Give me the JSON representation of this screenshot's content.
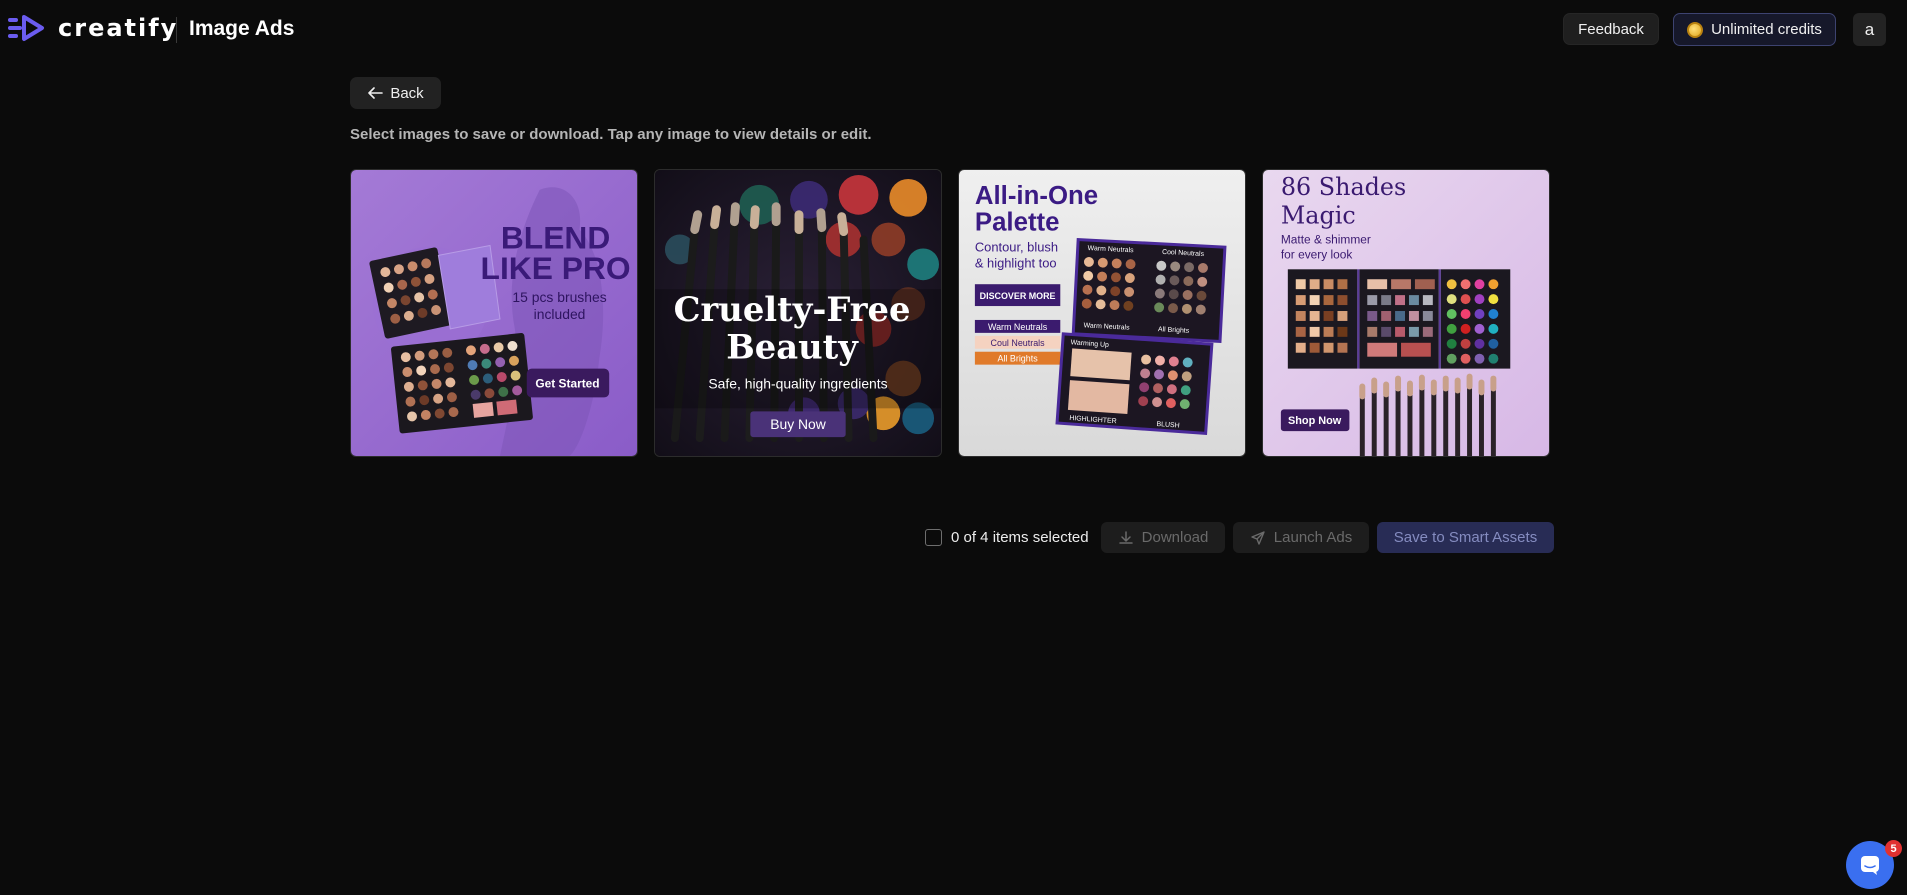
{
  "app": {
    "brand": "creatify",
    "page_title": "Image Ads"
  },
  "header": {
    "feedback_label": "Feedback",
    "credits_label": "Unlimited credits",
    "avatar_initial": "a",
    "credits_icon": "coin-icon"
  },
  "main": {
    "back_label": "Back",
    "instructions": "Select images to save or download. Tap any image to view details or edit."
  },
  "ads": [
    {
      "headline_line1": "BLEND",
      "headline_line2": "LIKE PRO",
      "sub_line1": "15 pcs brushes",
      "sub_line2": "included",
      "cta": "Get Started"
    },
    {
      "headline_line1": "Cruelty-Free",
      "headline_line2": "Beauty",
      "sub": "Safe, high-quality ingredients",
      "cta": "Buy Now"
    },
    {
      "headline_line1": "All-in-One",
      "headline_line2": "Palette",
      "sub_line1": "Contour, blush",
      "sub_line2": "& highlight too",
      "cta": "DISCOVER MORE",
      "tag1": "Warm Neutrals",
      "tag2": "Coul Neutrals",
      "tag3": "All Brights",
      "pal_label1": "Warm Neutrals",
      "pal_label2": "Cool Neutrals",
      "pal_label3": "Warm Neutrals",
      "pal_label4": "All Brights",
      "pal_label5": "Warming Up",
      "pal_label6": "HIGHLIGHTER",
      "pal_label7": "BLUSH"
    },
    {
      "headline_line1": "86 Shades",
      "headline_line2": "Magic",
      "sub_line1": "Matte & shimmer",
      "sub_line2": "for every look",
      "cta": "Shop Now"
    }
  ],
  "actions": {
    "selected_text": "0 of 4 items selected",
    "download_label": "Download",
    "launch_label": "Launch Ads",
    "save_label": "Save to Smart Assets"
  },
  "chat": {
    "badge_count": "5"
  },
  "colors": {
    "background": "#0b0b0b",
    "accent_purple": "#3a1f6e",
    "save_button_bg": "#282c55",
    "chat_blue": "#3a6ff0",
    "badge_red": "#e03131"
  }
}
